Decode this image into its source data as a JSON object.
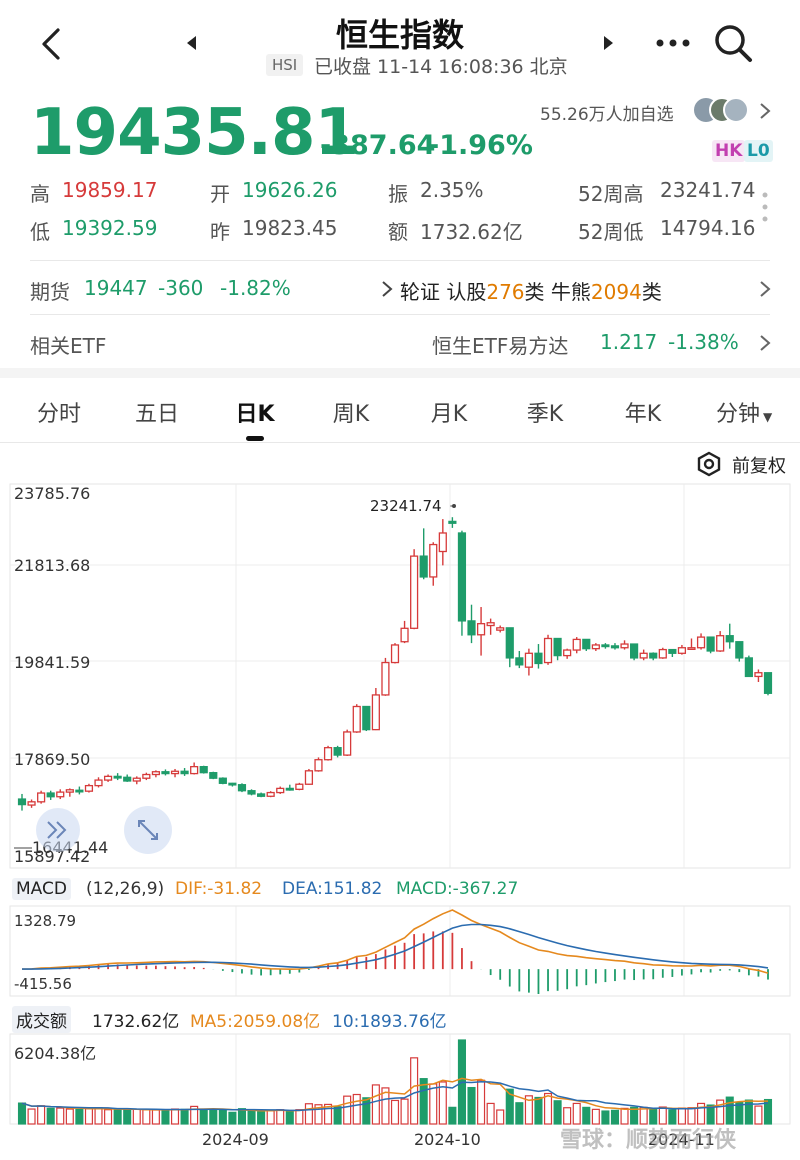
{
  "header": {
    "title": "恒生指数",
    "code": "HSI",
    "status": "已收盘 11-14 16:08:36 北京"
  },
  "quote": {
    "price": "19435.81",
    "change": "-387.64",
    "change_pct": "-1.96%",
    "followers": "55.26万人加自选",
    "badge_hk": "HK",
    "badge_lo": "L0"
  },
  "stats": {
    "high_label": "高",
    "high": "19859.17",
    "open_label": "开",
    "open": "19626.26",
    "amp_label": "振",
    "amp": "2.35%",
    "w52h_label": "52周高",
    "w52h": "23241.74",
    "low_label": "低",
    "low": "19392.59",
    "prev_label": "昨",
    "prev": "19823.45",
    "amount_label": "额",
    "amount": "1732.62亿",
    "w52l_label": "52周低",
    "w52l": "14794.16"
  },
  "futures": {
    "label": "期货",
    "price": "19447",
    "change": "-360",
    "pct": "-1.82%",
    "warrant_prefix": "轮证 认股",
    "warrant_count": "276",
    "warrant_mid": "类 牛熊",
    "cbbc_count": "2094",
    "cbbc_suffix": "类"
  },
  "etf": {
    "label": "相关ETF",
    "name": "恒生ETF易方达",
    "price": "1.217",
    "pct": "-1.38%"
  },
  "tabs": [
    "分时",
    "五日",
    "日K",
    "周K",
    "月K",
    "季K",
    "年K",
    "分钟"
  ],
  "active_tab": 2,
  "adjust_label": "前复权",
  "kline": {
    "y_labels": [
      "23785.76",
      "21813.68",
      "19841.59",
      "17869.50",
      "15897.42"
    ],
    "max_label": "23241.74",
    "min_label": "16441.44"
  },
  "macd": {
    "label": "MACD",
    "params": "(12,26,9)",
    "dif": "DIF:-31.82",
    "dea": "DEA:151.82",
    "macd": "MACD:-367.27",
    "y_top": "1328.79",
    "y_bottom": "-415.56"
  },
  "volume": {
    "label": "成交额",
    "value": "1732.62亿",
    "ma5": "MA5:2059.08亿",
    "ma10": "10:1893.76亿",
    "y_top": "6204.38亿"
  },
  "x_labels": [
    "2024-09",
    "2024-10",
    "2024-11"
  ],
  "watermark": "雪球：顺势而行侠",
  "colors": {
    "up": "#d63a3a",
    "down": "#1e9c6a",
    "dif": "#e5891e",
    "dea": "#2b6cb0"
  },
  "chart_data": {
    "type": "candlestick",
    "candles": [
      [
        17150,
        17260,
        16900,
        17030
      ],
      [
        17020,
        17140,
        16960,
        17090
      ],
      [
        17090,
        17330,
        17050,
        17280
      ],
      [
        17280,
        17330,
        17130,
        17200
      ],
      [
        17200,
        17360,
        17150,
        17300
      ],
      [
        17300,
        17380,
        17200,
        17350
      ],
      [
        17340,
        17420,
        17250,
        17320
      ],
      [
        17320,
        17480,
        17290,
        17440
      ],
      [
        17440,
        17620,
        17400,
        17560
      ],
      [
        17560,
        17680,
        17520,
        17640
      ],
      [
        17640,
        17710,
        17560,
        17620
      ],
      [
        17620,
        17680,
        17520,
        17540
      ],
      [
        17540,
        17640,
        17470,
        17600
      ],
      [
        17600,
        17720,
        17560,
        17680
      ],
      [
        17680,
        17770,
        17620,
        17740
      ],
      [
        17740,
        17790,
        17660,
        17700
      ],
      [
        17700,
        17800,
        17620,
        17750
      ],
      [
        17750,
        17820,
        17650,
        17700
      ],
      [
        17700,
        17940,
        17680,
        17850
      ],
      [
        17850,
        17870,
        17700,
        17720
      ],
      [
        17720,
        17740,
        17580,
        17600
      ],
      [
        17600,
        17620,
        17470,
        17490
      ],
      [
        17490,
        17500,
        17420,
        17460
      ],
      [
        17460,
        17490,
        17300,
        17330
      ],
      [
        17330,
        17360,
        17230,
        17260
      ],
      [
        17260,
        17290,
        17190,
        17210
      ],
      [
        17210,
        17320,
        17190,
        17290
      ],
      [
        17290,
        17420,
        17260,
        17380
      ],
      [
        17380,
        17460,
        17330,
        17360
      ],
      [
        17360,
        17500,
        17340,
        17470
      ],
      [
        17470,
        17800,
        17460,
        17760
      ],
      [
        17760,
        18050,
        17740,
        18000
      ],
      [
        18000,
        18300,
        17980,
        18260
      ],
      [
        18260,
        18300,
        18050,
        18100
      ],
      [
        18100,
        18650,
        18080,
        18600
      ],
      [
        18600,
        19200,
        18580,
        19150
      ],
      [
        19150,
        19140,
        18620,
        18650
      ],
      [
        18650,
        19550,
        18640,
        19400
      ],
      [
        19400,
        20200,
        19380,
        20100
      ],
      [
        20100,
        20520,
        20080,
        20480
      ],
      [
        20550,
        21000,
        20520,
        20840
      ],
      [
        20840,
        22550,
        20820,
        22400
      ],
      [
        22400,
        23000,
        21900,
        21950
      ],
      [
        21950,
        22700,
        21760,
        22650
      ],
      [
        22500,
        23200,
        22200,
        22900
      ],
      [
        23150,
        23241,
        23010,
        23110
      ],
      [
        22900,
        22950,
        20680,
        21000
      ],
      [
        21000,
        21350,
        20520,
        20700
      ],
      [
        20700,
        21300,
        20250,
        20940
      ],
      [
        20900,
        21050,
        20700,
        20960
      ],
      [
        20800,
        20900,
        20750,
        20850
      ],
      [
        20850,
        20780,
        20000,
        20200
      ],
      [
        20200,
        20350,
        19980,
        20050
      ],
      [
        20000,
        20400,
        19820,
        20300
      ],
      [
        20300,
        20500,
        19970,
        20080
      ],
      [
        20100,
        20700,
        20050,
        20620
      ],
      [
        20620,
        20580,
        20150,
        20250
      ],
      [
        20250,
        20400,
        20180,
        20370
      ],
      [
        20370,
        20650,
        20300,
        20600
      ],
      [
        20600,
        20580,
        20350,
        20400
      ],
      [
        20400,
        20520,
        20350,
        20480
      ],
      [
        20480,
        20520,
        20400,
        20460
      ],
      [
        20460,
        20520,
        20380,
        20420
      ],
      [
        20420,
        20580,
        20380,
        20500
      ],
      [
        20500,
        20380,
        20150,
        20200
      ],
      [
        20200,
        20380,
        20150,
        20300
      ],
      [
        20300,
        20320,
        20150,
        20200
      ],
      [
        20200,
        20420,
        20180,
        20380
      ],
      [
        20380,
        20370,
        20220,
        20300
      ],
      [
        20300,
        20480,
        20270,
        20420
      ],
      [
        20420,
        20620,
        20400,
        20420
      ],
      [
        20420,
        20730,
        20380,
        20650
      ],
      [
        20650,
        20600,
        20300,
        20350
      ],
      [
        20350,
        20780,
        20330,
        20680
      ],
      [
        20680,
        20940,
        20400,
        20550
      ],
      [
        20550,
        20500,
        20120,
        20200
      ],
      [
        20200,
        20250,
        19800,
        19800
      ],
      [
        19800,
        19950,
        19680,
        19880
      ],
      [
        19880,
        19859,
        19392,
        19435
      ]
    ],
    "y_range": [
      15897.42,
      23785.76
    ],
    "x_ticks": [
      "2024-09",
      "2024-10",
      "2024-11"
    ]
  }
}
